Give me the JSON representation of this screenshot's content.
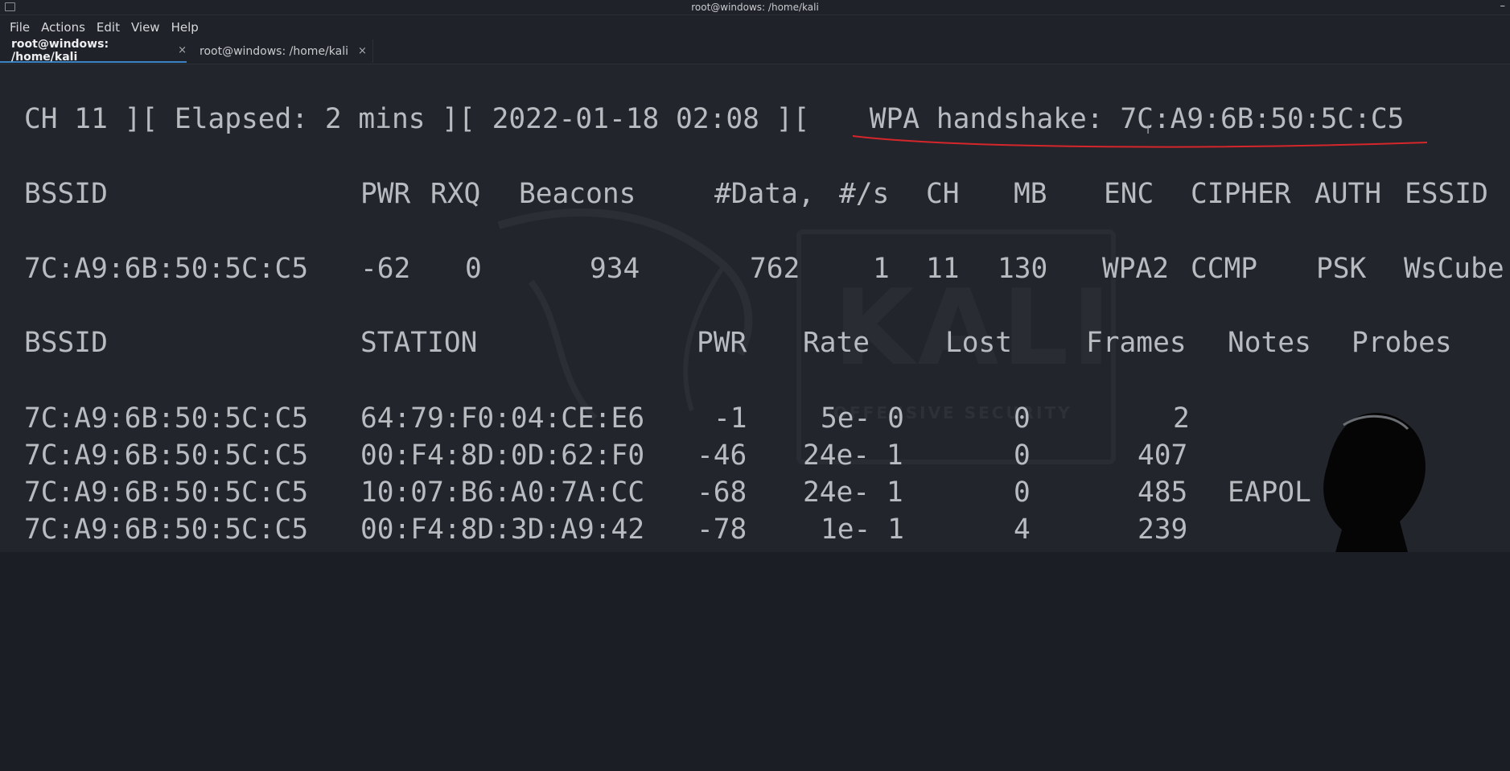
{
  "window": {
    "title": "root@windows: /home/kali",
    "minimize": "–"
  },
  "menu": [
    "File",
    "Actions",
    "Edit",
    "View",
    "Help"
  ],
  "tabs": [
    {
      "label": "root@windows: /home/kali",
      "close": "×",
      "active": true
    },
    {
      "label": "root@windows: /home/kali",
      "close": "×",
      "active": false
    }
  ],
  "terminal": {
    "status": {
      "ch": "CH 11 ][ Elapsed: 2 mins ][ 2022-01-18 02:08 ][",
      "handshake": " WPA handshake: 7C:A9:6B:50:5C:C5"
    },
    "ap_header": {
      "bssid": "BSSID",
      "pwr": "PWR",
      "rxq": "RXQ",
      "beacons": "Beacons",
      "data": "#Data,",
      "rate": "#/s",
      "ch": "CH",
      "mb": "MB",
      "enc": "ENC",
      "cipher": "CIPHER",
      "auth": "AUTH",
      "essid": "ESSID"
    },
    "ap_rows": [
      {
        "bssid": "7C:A9:6B:50:5C:C5",
        "pwr": "-62",
        "rxq": "0",
        "beacons": "934",
        "data": "762",
        "rate": "1",
        "ch": "11",
        "mb": "130",
        "enc": "WPA2",
        "cipher": "CCMP",
        "auth": "PSK",
        "essid": "WsCube"
      }
    ],
    "sta_header": {
      "bssid": "BSSID",
      "station": "STATION",
      "pwr": "PWR",
      "rate": "Rate",
      "lost": "Lost",
      "frames": "Frames",
      "notes": "Notes",
      "probes": "Probes"
    },
    "sta_rows": [
      {
        "bssid": "7C:A9:6B:50:5C:C5",
        "station": "64:79:F0:04:CE:E6",
        "pwr": "-1",
        "rate": "5e- 0",
        "lost": "0",
        "frames": "2",
        "notes": ""
      },
      {
        "bssid": "7C:A9:6B:50:5C:C5",
        "station": "00:F4:8D:0D:62:F0",
        "pwr": "-46",
        "rate": "24e- 1",
        "lost": "0",
        "frames": "407",
        "notes": ""
      },
      {
        "bssid": "7C:A9:6B:50:5C:C5",
        "station": "10:07:B6:A0:7A:CC",
        "pwr": "-68",
        "rate": "24e- 1",
        "lost": "0",
        "frames": "485",
        "notes": "EAPOL"
      },
      {
        "bssid": "7C:A9:6B:50:5C:C5",
        "station": "00:F4:8D:3D:A9:42",
        "pwr": "-78",
        "rate": "1e- 1",
        "lost": "4",
        "frames": "239",
        "notes": ""
      }
    ],
    "annotation_color": "#d4262b"
  }
}
